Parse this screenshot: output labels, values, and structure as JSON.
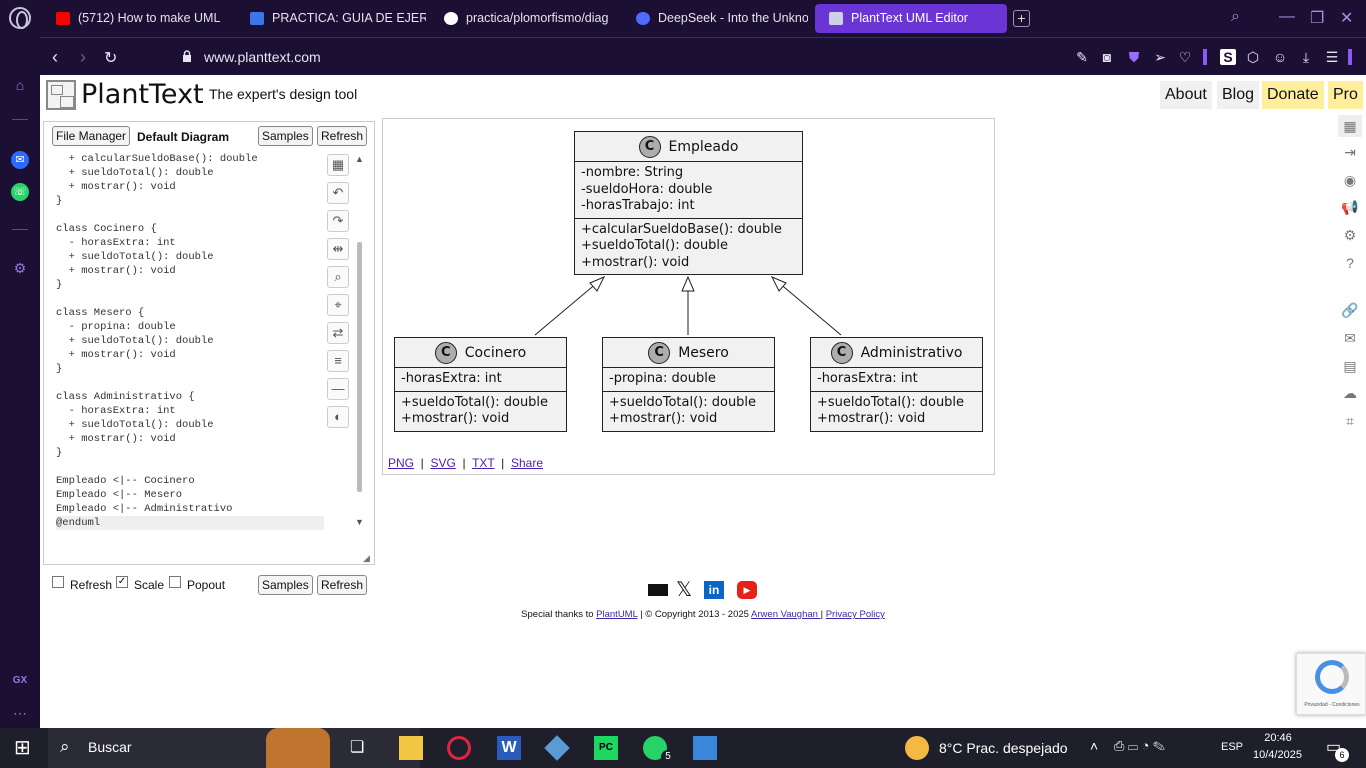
{
  "tabs": [
    {
      "label": "(5712) How to make UML",
      "color": "#ff0000"
    },
    {
      "label": "PRACTICA: GUIA DE EJER",
      "color": "#3b78e7"
    },
    {
      "label": "practica/plomorfismo/diag",
      "color": "#ffffff"
    },
    {
      "label": "DeepSeek - Into the Unkno",
      "color": "#4d6bfe"
    },
    {
      "label": "PlantText UML Editor",
      "color": "#cfcfe8"
    }
  ],
  "address": {
    "url": "www.planttext.com"
  },
  "header": {
    "brand": "PlantText",
    "tagline": "The expert's design tool",
    "nav": [
      "About",
      "Blog",
      "Donate",
      "Pro"
    ]
  },
  "editor": {
    "file_manager": "File Manager",
    "diagram_name": "Default Diagram",
    "samples": "Samples",
    "refresh": "Refresh",
    "code_lines": [
      "  + calcularSueldoBase(): double",
      "  + sueldoTotal(): double",
      "  + mostrar(): void",
      "}",
      "",
      "class Cocinero {",
      "  - horasExtra: int",
      "  + sueldoTotal(): double",
      "  + mostrar(): void",
      "}",
      "",
      "class Mesero {",
      "  - propina: double",
      "  + sueldoTotal(): double",
      "  + mostrar(): void",
      "}",
      "",
      "class Administrativo {",
      "  - horasExtra: int",
      "  + sueldoTotal(): double",
      "  + mostrar(): void",
      "}",
      "",
      "Empleado <|-- Cocinero",
      "Empleado <|-- Mesero",
      "Empleado <|-- Administrativo",
      "@enduml"
    ],
    "opt_refresh": "Refresh",
    "opt_scale": "Scale",
    "opt_popout": "Popout"
  },
  "diagram": {
    "classes": [
      {
        "name": "Empleado",
        "attrs": [
          "-nombre: String",
          "-sueldoHora: double",
          "-horasTrabajo: int"
        ],
        "methods": [
          "+calcularSueldoBase(): double",
          "+sueldoTotal(): double",
          "+mostrar(): void"
        ]
      },
      {
        "name": "Cocinero",
        "attrs": [
          "-horasExtra: int"
        ],
        "methods": [
          "+sueldoTotal(): double",
          "+mostrar(): void"
        ]
      },
      {
        "name": "Mesero",
        "attrs": [
          "-propina: double"
        ],
        "methods": [
          "+sueldoTotal(): double",
          "+mostrar(): void"
        ]
      },
      {
        "name": "Administrativo",
        "attrs": [
          "-horasExtra: int"
        ],
        "methods": [
          "+sueldoTotal(): double",
          "+mostrar(): void"
        ]
      }
    ],
    "links": [
      "PNG",
      "SVG",
      "TXT",
      "Share"
    ]
  },
  "footer": {
    "thanks": "Special thanks to ",
    "plantuml": "PlantUML",
    "copyright": " | © Copyright 2013 - 2025 ",
    "author": "Arwen Vaughan ",
    "privacy": "Privacy Policy"
  },
  "taskbar": {
    "search": "Buscar",
    "weather": "8°C  Prac. despejado",
    "lang": "ESP",
    "time": "20:46",
    "date": "10/4/2025",
    "whatsapp_badge": "5",
    "notif": "6"
  },
  "recaptcha": "Privacidad - Condiciones",
  "gx": "GX"
}
